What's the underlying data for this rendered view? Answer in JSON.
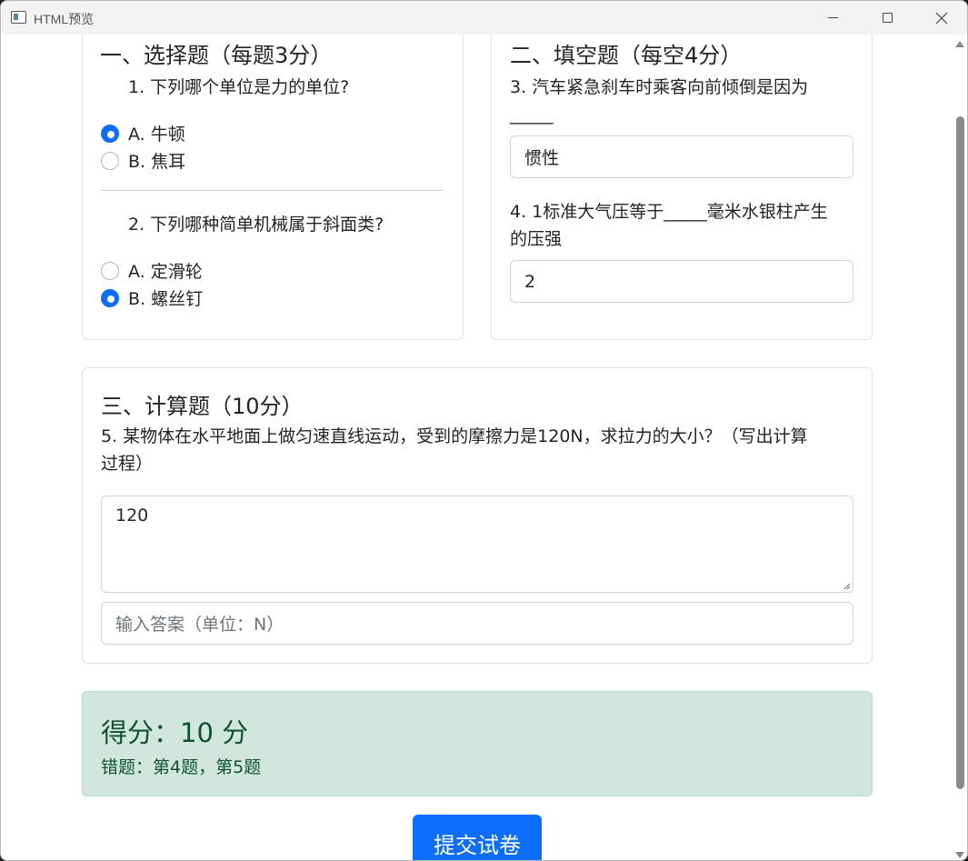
{
  "window": {
    "title": "HTML预览"
  },
  "section1": {
    "title": "一、选择题（每题3分）",
    "q1": {
      "text": "1. 下列哪个单位是力的单位?",
      "options": [
        {
          "label": "A. 牛顿",
          "checked": true
        },
        {
          "label": "B. 焦耳",
          "checked": false
        }
      ]
    },
    "q2": {
      "text": "2. 下列哪种简单机械属于斜面类?",
      "options": [
        {
          "label": "A. 定滑轮",
          "checked": false
        },
        {
          "label": "B. 螺丝钉",
          "checked": true
        }
      ]
    }
  },
  "section2": {
    "title": "二、填空题（每空4分）",
    "q3": {
      "line1": "3. 汽车紧急刹车时乘客向前倾倒是因为",
      "line2": "_____",
      "value": "惯性"
    },
    "q4": {
      "line1": "4. 1标准大气压等于_____毫米水银柱产生",
      "line2": "的压强",
      "value": "2"
    }
  },
  "section3": {
    "title": "三、计算题（10分）",
    "q5": {
      "line1": "5. 某物体在水平地面上做匀速直线运动，受到的摩擦力是120N，求拉力的大小？（写出计算",
      "line2": "过程）",
      "process_value": "120",
      "answer_placeholder": "输入答案（单位：N）"
    }
  },
  "result": {
    "score": "得分：10 分",
    "wrong": "错题：第4题，第5题"
  },
  "submit_label": "提交试卷"
}
